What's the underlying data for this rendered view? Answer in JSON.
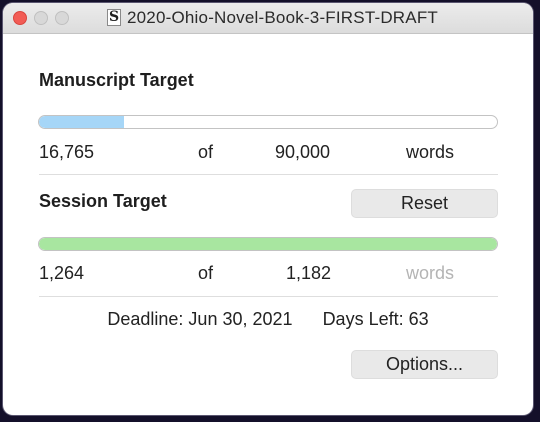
{
  "window": {
    "title": "2020-Ohio-Novel-Book-3-FIRST-DRAFT",
    "doc_icon_glyph": "S"
  },
  "manuscript": {
    "heading": "Manuscript Target",
    "current": "16,765",
    "of_label": "of",
    "target": "90,000",
    "unit": "words",
    "progress_fraction": 0.186,
    "bar_color": "#a6d6f7"
  },
  "session": {
    "heading": "Session Target",
    "reset_label": "Reset",
    "current": "1,264",
    "of_label": "of",
    "target": "1,182",
    "unit": "words",
    "progress_fraction": 1.0,
    "bar_color": "#a8e6a0"
  },
  "deadline": {
    "deadline_text": "Deadline: Jun 30, 2021",
    "days_left_text": "Days Left: 63"
  },
  "options_label": "Options..."
}
